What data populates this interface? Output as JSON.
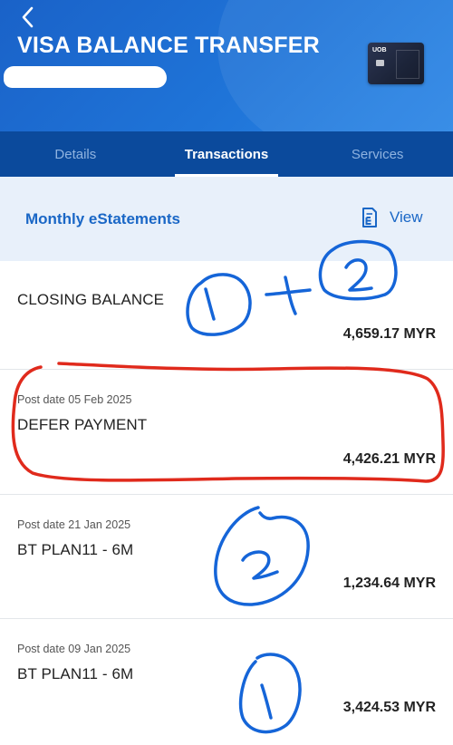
{
  "header": {
    "title": "VISA BALANCE TRANSFER",
    "card_brand": "UOB",
    "back_icon": "chevron-left-icon"
  },
  "tabs": [
    {
      "label": "Details",
      "active": false
    },
    {
      "label": "Transactions",
      "active": true
    },
    {
      "label": "Services",
      "active": false
    }
  ],
  "estatements": {
    "label": "Monthly eStatements",
    "view_label": "View",
    "view_icon": "document-e-icon"
  },
  "closing_balance": {
    "label": "CLOSING BALANCE",
    "amount": "4,659.17 MYR"
  },
  "transactions": [
    {
      "date": "Post date 05 Feb 2025",
      "description": "DEFER PAYMENT",
      "amount": "4,426.21 MYR"
    },
    {
      "date": "Post date 21 Jan 2025",
      "description": "BT PLAN11 - 6M",
      "amount": "1,234.64 MYR"
    },
    {
      "date": "Post date 09 Jan 2025",
      "description": "BT PLAN11 - 6M",
      "amount": "3,424.53 MYR"
    }
  ],
  "annotations": {
    "handwritten": [
      "1",
      "+",
      "2",
      "2",
      "1"
    ],
    "red_color": "#e02a1c",
    "blue_color": "#1565d8"
  },
  "colors": {
    "header_blue": "#1f74d8",
    "tab_bar": "#0b4a9c",
    "accent": "#1a67c6",
    "estatement_bg": "#e8f0fa"
  }
}
